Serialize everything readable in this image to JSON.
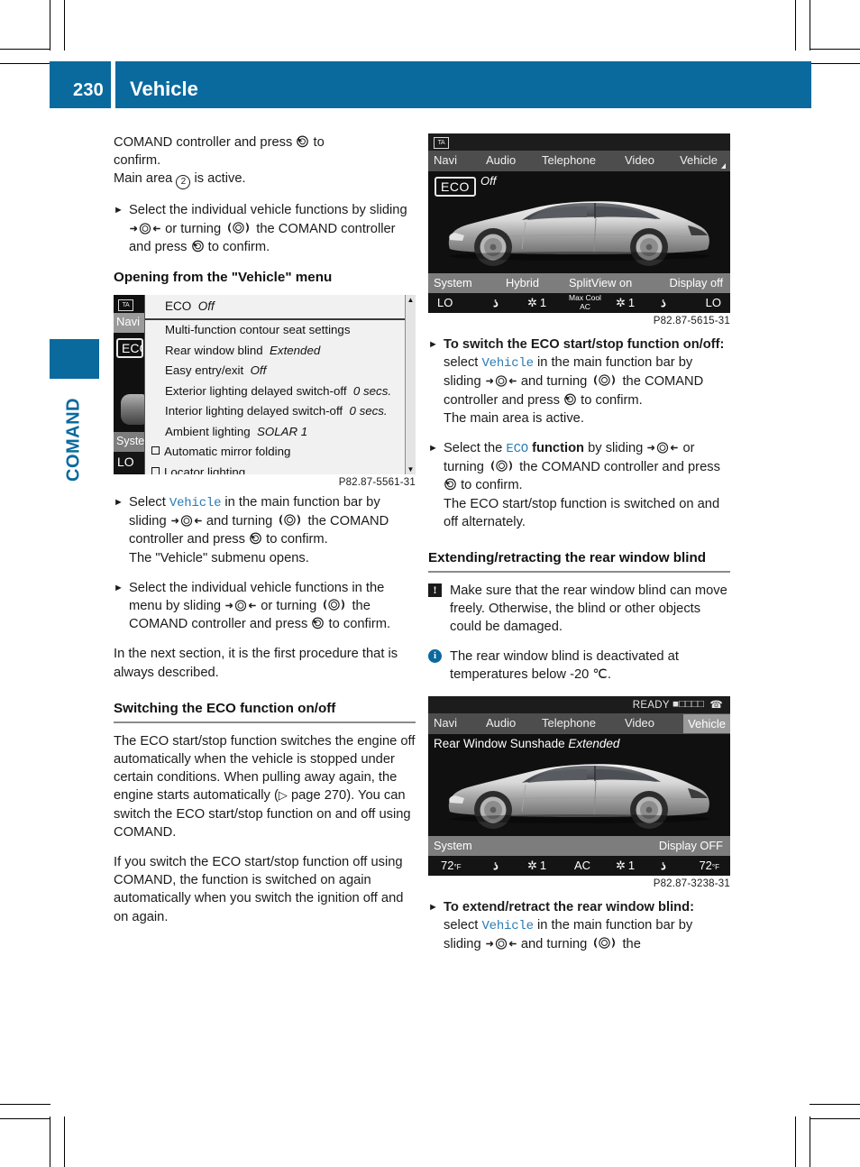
{
  "meta": {
    "page_number": "230",
    "chapter_title": "Vehicle",
    "side_tab_label": "COMAND",
    "accent_color": "#0a6a9e",
    "mono_color": "#2b7cb5"
  },
  "left_column": {
    "para_continued": {
      "line1_pre": "COMAND controller and press ",
      "line1_post": " to",
      "line2": "confirm.",
      "line3_pre": "Main area ",
      "line3_num": "2",
      "line3_post": " is active."
    },
    "step_select_functions": {
      "t1": "Select the individual vehicle functions by sliding ",
      "t2": " or turning ",
      "t3": " the COMAND controller and press ",
      "t4": " to confirm."
    },
    "heading_opening": "Opening from the \"Vehicle\" menu",
    "screenshot_menu": {
      "caption": "P82.87-5561-31",
      "ta_badge": "TA",
      "bg_menu_items": [
        "Navi",
        "ECO",
        "System",
        "LO"
      ],
      "overlay_header": {
        "label": "ECO",
        "value": "Off"
      },
      "overlay_items": [
        {
          "label": "Multi-function contour seat settings",
          "value": "",
          "checkbox": false
        },
        {
          "label": "Rear window blind",
          "value": "Extended",
          "checkbox": false
        },
        {
          "label": "Easy entry/exit",
          "value": "Off",
          "checkbox": false
        },
        {
          "label": "Exterior lighting delayed switch-off",
          "value": "0 secs.",
          "checkbox": false
        },
        {
          "label": "Interior lighting delayed switch-off",
          "value": "0 secs.",
          "checkbox": false
        },
        {
          "label": "Ambient lighting",
          "value": "SOLAR   1",
          "checkbox": false
        },
        {
          "label": "Automatic mirror folding",
          "value": "",
          "checkbox": true
        },
        {
          "label": "Locator lighting",
          "value": "",
          "checkbox": true
        }
      ]
    },
    "step_select_vehicle": {
      "t1": "Select ",
      "mono": "Vehicle",
      "t2": " in the main function bar by sliding ",
      "t3": " and turning ",
      "t4": " the COMAND controller and press ",
      "t5": " to confirm.",
      "result": "The \"Vehicle\" submenu opens."
    },
    "step_select_in_menu": {
      "t1": "Select the individual vehicle functions in the menu by sliding ",
      "t2": " or turning ",
      "t3": " the COMAND controller and press ",
      "t4": " to confirm."
    },
    "para_next_section": "In the next section, it is the first procedure that is always described.",
    "heading_switching_eco": "Switching the ECO function on/off",
    "para_eco_1_a": "The ECO start/stop function switches the engine off automatically when the vehicle is stopped under certain conditions. When pulling away again, the engine starts automatically (",
    "para_eco_1_ref": " page 270",
    "para_eco_1_b": "). You can switch the ECO start/stop function on and off using COMAND.",
    "para_eco_2": "If you switch the ECO start/stop function off using COMAND, the function is switched on again automatically when you switch the ignition off and on again."
  },
  "right_column": {
    "screenshot_eco": {
      "caption": "P82.87-5615-31",
      "ta_badge": "TA",
      "menu_bar": [
        "Navi",
        "Audio",
        "Telephone",
        "Video",
        "Vehicle"
      ],
      "selected_menu": "Vehicle",
      "eco_button": "ECO",
      "eco_state": "Off",
      "soft_bar": [
        "System",
        "Hybrid",
        "SplitView on",
        "Display off"
      ],
      "climate_bar": {
        "left_temp": "LO",
        "left_fan": "1",
        "center_top": "Max Cool",
        "center_bottom": "AC",
        "right_fan": "1",
        "right_temp": "LO"
      }
    },
    "step_switch_eco": {
      "bold": "To switch the ECO start/stop function on/off:",
      "t1": " select ",
      "mono": "Vehicle",
      "t2": " in the main function bar by sliding ",
      "t3": " and turning ",
      "t4": " the COMAND controller and press ",
      "t5": " to confirm.",
      "result": "The main area is active."
    },
    "step_select_eco_fn": {
      "t1": "Select the ",
      "mono": "ECO",
      "bold": " function",
      "t2": " by sliding ",
      "t3": " or turning ",
      "t4": " the COMAND controller and press ",
      "t5": " to confirm.",
      "result": "The ECO start/stop function is switched on and off alternately."
    },
    "heading_blind": "Extending/retracting the rear window blind",
    "warning_text": "Make sure that the rear window blind can move freely. Otherwise, the blind or other objects could be damaged.",
    "warning_icon": "!",
    "info_text": "The rear window blind is deactivated at temperatures below -20 ℃.",
    "info_icon": "i",
    "screenshot_blind": {
      "caption": "P82.87-3238-31",
      "status_ready": "READY",
      "signal_bars": "■□□□□",
      "menu_bar": [
        "Navi",
        "Audio",
        "Telephone",
        "Video",
        "Vehicle"
      ],
      "selected_menu": "Vehicle",
      "main_label": "Rear Window Sunshade",
      "main_value": "Extended",
      "soft_bar": [
        "System",
        "Display OFF"
      ],
      "climate_bar": {
        "left_temp": "72",
        "left_unit": "°F",
        "left_fan": "1",
        "center": "AC",
        "right_fan": "1",
        "right_temp": "72",
        "right_unit": "°F"
      }
    },
    "step_extend_blind": {
      "bold": "To extend/retract the rear window blind:",
      "t1": " select ",
      "mono": "Vehicle",
      "t2": " in the main function bar by sliding ",
      "t3": " and turning ",
      "t4": " the"
    }
  }
}
